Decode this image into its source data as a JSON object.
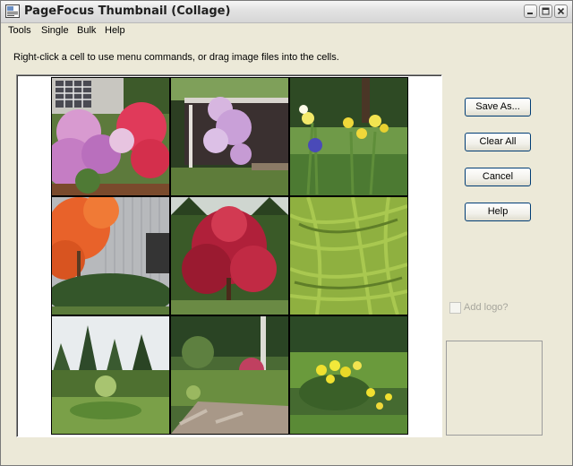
{
  "window": {
    "title": "PageFocus Thumbnail  (Collage)",
    "icon": "app-thumbnail-icon"
  },
  "menu": [
    "Tools",
    "Single",
    "Bulk",
    "Help"
  ],
  "instructions": "Right-click a cell to use menu commands, or drag image files into the cells.",
  "buttons": {
    "save_as": "Save As...",
    "clear_all": "Clear All",
    "cancel": "Cancel",
    "help": "Help"
  },
  "add_logo": {
    "label": "Add logo?",
    "checked": false,
    "enabled": false
  },
  "collage": {
    "rows": 3,
    "cols": 3,
    "cells": [
      "pink rhododendrons by a house",
      "flowering tree near a porch",
      "yellow and blue irises",
      "orange maple by a house",
      "red japanese maple",
      "green bamboo foliage",
      "garden lawn with evergreens",
      "rock garden path",
      "yellow daffodils"
    ]
  },
  "colors": {
    "button_border": "#003c74",
    "window_bg": "#ece9d8"
  }
}
